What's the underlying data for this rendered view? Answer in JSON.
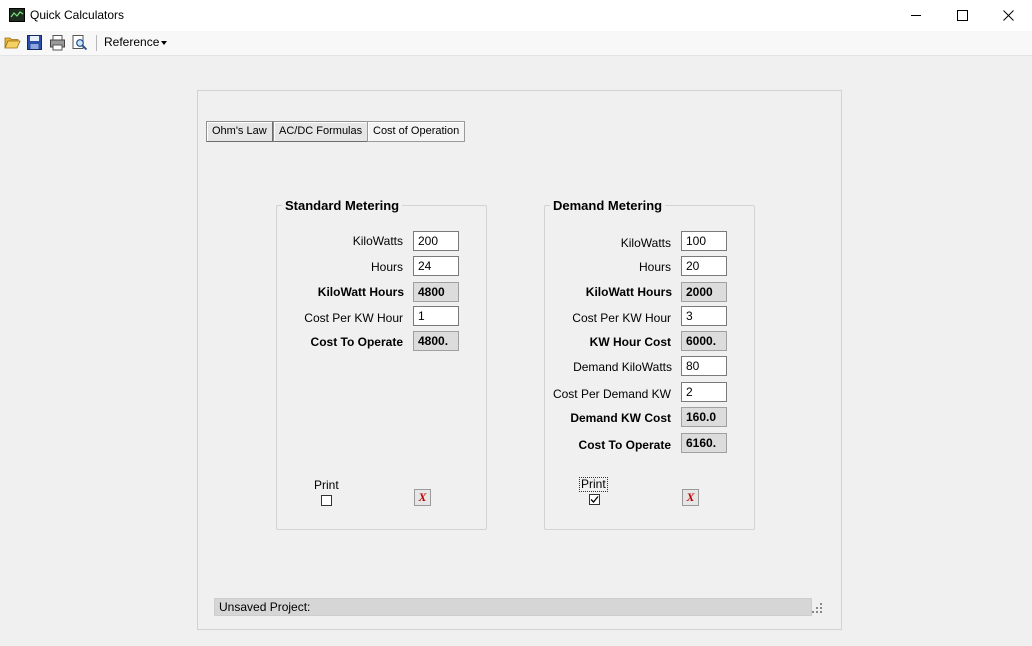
{
  "window": {
    "title": "Quick Calculators"
  },
  "toolbar": {
    "icons": [
      "open-folder-icon",
      "save-icon",
      "print-icon",
      "print-preview-icon"
    ],
    "reference_label": "Reference"
  },
  "tabs": [
    {
      "label": "Ohm's Law",
      "active": false
    },
    {
      "label": "AC/DC Formulas",
      "active": false
    },
    {
      "label": "Cost of Operation",
      "active": true
    }
  ],
  "standard": {
    "title": "Standard Metering",
    "kilowatts_label": "KiloWatts",
    "kilowatts_value": "200",
    "hours_label": "Hours",
    "hours_value": "24",
    "kwh_label": "KiloWatt Hours",
    "kwh_value": "4800",
    "cost_per_kwh_label": "Cost Per KW Hour",
    "cost_per_kwh_value": "1",
    "cost_to_operate_label": "Cost To Operate",
    "cost_to_operate_value": "4800.",
    "print_label": "Print",
    "print_checked": false,
    "clear_label": "X"
  },
  "demand": {
    "title": "Demand Metering",
    "kilowatts_label": "KiloWatts",
    "kilowatts_value": "100",
    "hours_label": "Hours",
    "hours_value": "20",
    "kwh_label": "KiloWatt Hours",
    "kwh_value": "2000",
    "cost_per_kwh_label": "Cost Per KW Hour",
    "cost_per_kwh_value": "3",
    "kwh_cost_label": "KW Hour Cost",
    "kwh_cost_value": "6000.",
    "demand_kw_label": "Demand KiloWatts",
    "demand_kw_value": "80",
    "cost_per_demand_label": "Cost Per Demand KW",
    "cost_per_demand_value": "2",
    "demand_kw_cost_label": "Demand KW Cost",
    "demand_kw_cost_value": "160.0",
    "cost_to_operate_label": "Cost  To Operate",
    "cost_to_operate_value": "6160.",
    "print_label": "Print",
    "print_checked": true,
    "clear_label": "X"
  },
  "status": {
    "text": "Unsaved Project:"
  }
}
